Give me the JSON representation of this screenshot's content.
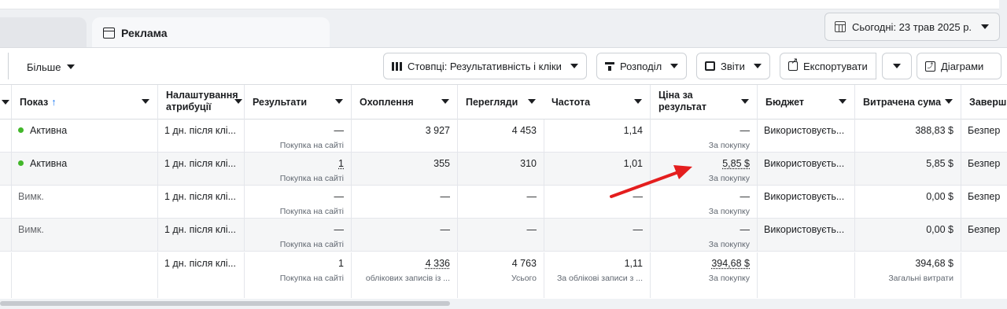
{
  "tabs": {
    "active_label": "Реклама"
  },
  "date_picker": {
    "label": "Сьогодні: 23 трав 2025 р."
  },
  "toolbar": {
    "more_label": "Більше",
    "columns_label": "Стовпці: Результативність і кліки",
    "breakdown_label": "Розподіл",
    "reports_label": "Звіти",
    "export_label": "Експортувати",
    "charts_label": "Діаграми"
  },
  "table": {
    "headers": {
      "delivery": "Показ",
      "attribution": "Налаштування атрибуції",
      "results": "Результати",
      "reach": "Охоплення",
      "impressions": "Перегляди",
      "frequency": "Частота",
      "cost_per_result": "Ціна за результат",
      "budget": "Бюджет",
      "amount_spent": "Витрачена сума",
      "ends": "Заверш"
    },
    "rows": [
      {
        "delivery": "Активна",
        "active": true,
        "attribution": "1 дн. після клі...",
        "results": "—",
        "results_sub": "Покупка на сайті",
        "reach": "3 927",
        "impressions": "4 453",
        "frequency": "1,14",
        "cost": "—",
        "cost_sub": "За покупку",
        "budget": "Використовуєть...",
        "spent": "388,83 $",
        "ends": "Безпер"
      },
      {
        "delivery": "Активна",
        "active": true,
        "attribution": "1 дн. після клі...",
        "results": "1",
        "results_sub": "Покупка на сайті",
        "reach": "355",
        "impressions": "310",
        "frequency": "1,01",
        "cost": "5,85 $",
        "cost_sub": "За покупку",
        "budget": "Використовуєть...",
        "spent": "5,85 $",
        "ends": "Безпер"
      },
      {
        "delivery": "Вимк.",
        "active": false,
        "attribution": "1 дн. після клі...",
        "results": "—",
        "results_sub": "Покупка на сайті",
        "reach": "—",
        "impressions": "—",
        "frequency": "—",
        "cost": "—",
        "cost_sub": "За покупку",
        "budget": "Використовуєть...",
        "spent": "0,00 $",
        "ends": "Безпер"
      },
      {
        "delivery": "Вимк.",
        "active": false,
        "attribution": "1 дн. після клі...",
        "results": "—",
        "results_sub": "Покупка на сайті",
        "reach": "—",
        "impressions": "—",
        "frequency": "—",
        "cost": "—",
        "cost_sub": "За покупку",
        "budget": "Використовуєть...",
        "spent": "0,00 $",
        "ends": "Безпер"
      }
    ],
    "total": {
      "attribution": "1 дн. після клі...",
      "results": "1",
      "results_sub": "Покупка на сайті",
      "reach": "4 336",
      "reach_sub": "облікових записів із ...",
      "impressions": "4 763",
      "impressions_sub": "Усього",
      "frequency": "1,11",
      "frequency_sub": "За облікові записи з ...",
      "cost": "394,68 $",
      "cost_sub": "За покупку",
      "spent": "394,68 $",
      "spent_sub": "Загальні витрати"
    }
  },
  "annotation": {
    "arrow_color": "#e41e1e"
  },
  "colors": {
    "active_dot": "#42b72a",
    "sort_arrow": "#1877f2"
  }
}
